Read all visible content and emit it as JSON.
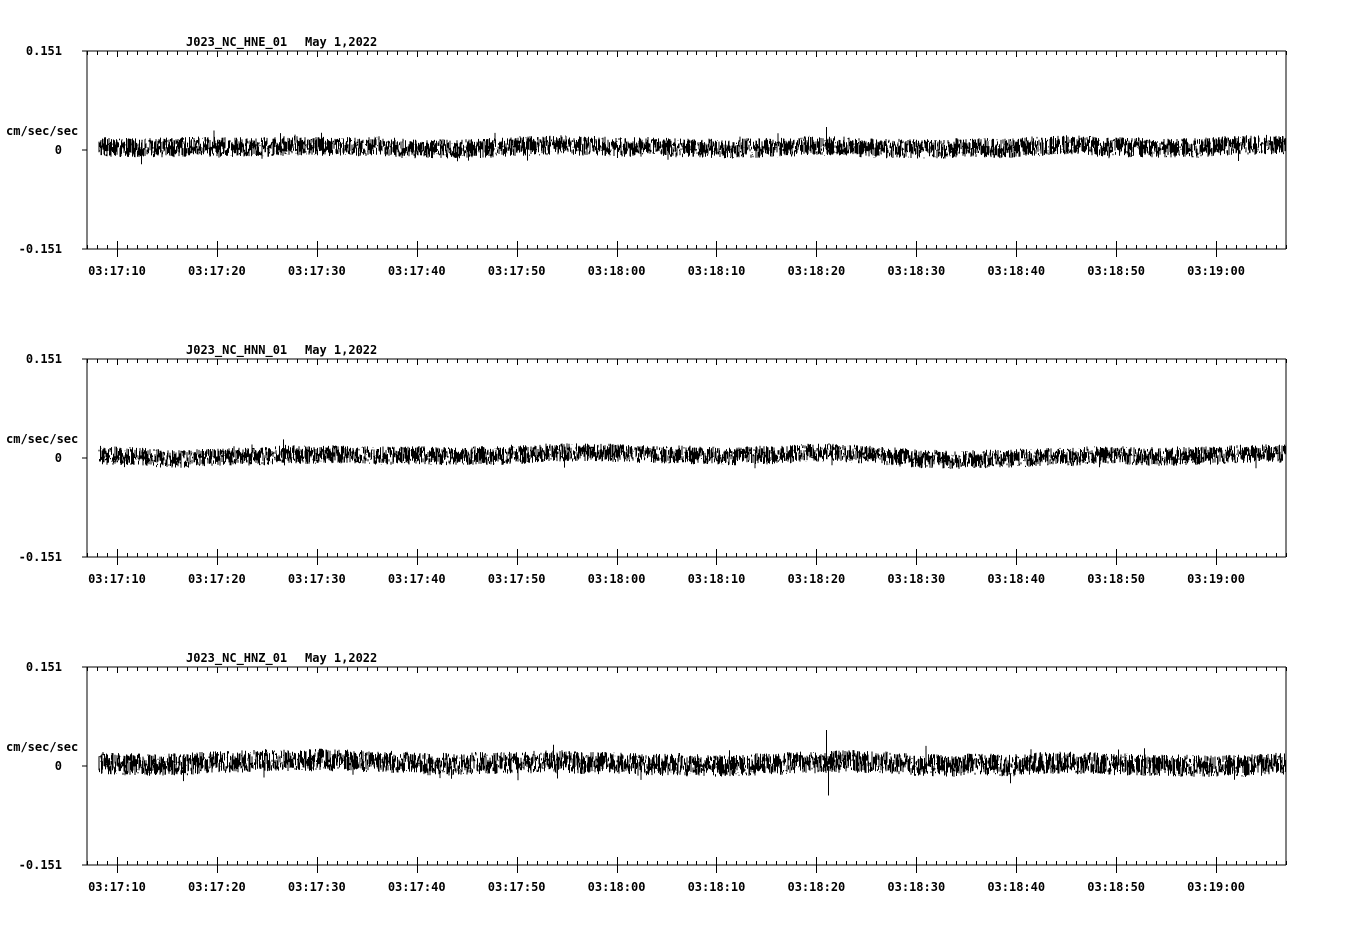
{
  "chart_data": [
    {
      "type": "line",
      "title": "J023_NC_HNE_01",
      "date": "May 1,2022",
      "ylabel": "cm/sec/sec",
      "yticks": [
        "0.151",
        "0",
        "-0.151"
      ],
      "ylim": [
        -0.151,
        0.151
      ],
      "xticks": [
        "03:17:10",
        "03:17:20",
        "03:17:30",
        "03:17:40",
        "03:17:50",
        "03:18:00",
        "03:18:10",
        "03:18:20",
        "03:18:30",
        "03:18:40",
        "03:18:50",
        "03:19:00"
      ],
      "xlim_seconds_after_03_17_00": [
        7,
        127
      ],
      "trace": {
        "noise_amplitude": 0.015,
        "spikes": [
          {
            "t": 81.0,
            "a": 0.035
          }
        ],
        "color": "#000000"
      }
    },
    {
      "type": "line",
      "title": "J023_NC_HNN_01",
      "date": "May 1,2022",
      "ylabel": "cm/sec/sec",
      "yticks": [
        "0.151",
        "0",
        "-0.151"
      ],
      "ylim": [
        -0.151,
        0.151
      ],
      "xticks": [
        "03:17:10",
        "03:17:20",
        "03:17:30",
        "03:17:40",
        "03:17:50",
        "03:18:00",
        "03:18:10",
        "03:18:20",
        "03:18:30",
        "03:18:40",
        "03:18:50",
        "03:19:00"
      ],
      "xlim_seconds_after_03_17_00": [
        7,
        127
      ],
      "trace": {
        "noise_amplitude": 0.014,
        "spikes": [],
        "color": "#000000"
      }
    },
    {
      "type": "line",
      "title": "J023_NC_HNZ_01",
      "date": "May 1,2022",
      "ylabel": "cm/sec/sec",
      "yticks": [
        "0.151",
        "0",
        "-0.151"
      ],
      "ylim": [
        -0.151,
        0.151
      ],
      "xticks": [
        "03:17:10",
        "03:17:20",
        "03:17:30",
        "03:17:40",
        "03:17:50",
        "03:18:00",
        "03:18:10",
        "03:18:20",
        "03:18:30",
        "03:18:40",
        "03:18:50",
        "03:19:00"
      ],
      "xlim_seconds_after_03_17_00": [
        7,
        127
      ],
      "trace": {
        "noise_amplitude": 0.017,
        "spikes": [
          {
            "t": 81.0,
            "a": 0.055
          },
          {
            "t": 81.2,
            "a": -0.045
          }
        ],
        "color": "#000000"
      }
    }
  ]
}
